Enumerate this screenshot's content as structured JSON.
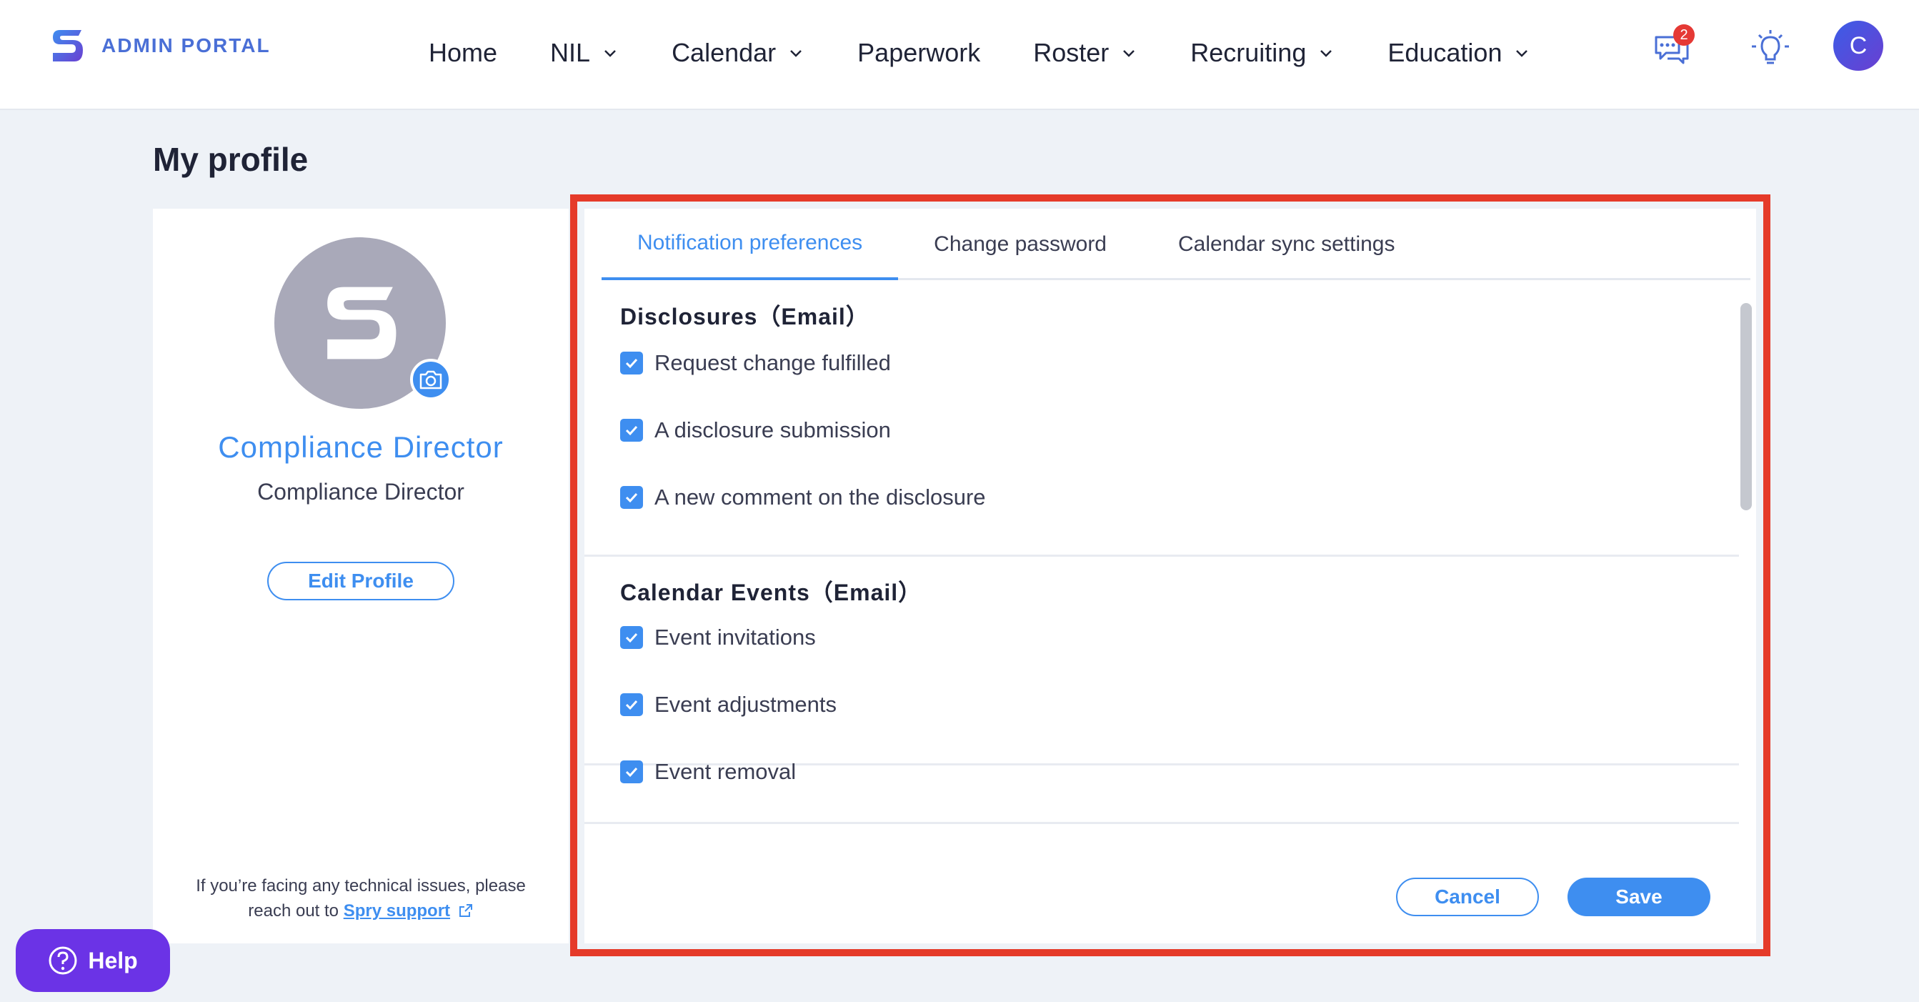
{
  "brand": {
    "name": "ADMIN PORTAL"
  },
  "nav": {
    "items": [
      {
        "label": "Home",
        "dropdown": false
      },
      {
        "label": "NIL",
        "dropdown": true
      },
      {
        "label": "Calendar",
        "dropdown": true
      },
      {
        "label": "Paperwork",
        "dropdown": false
      },
      {
        "label": "Roster",
        "dropdown": true
      },
      {
        "label": "Recruiting",
        "dropdown": true
      },
      {
        "label": "Education",
        "dropdown": true
      }
    ],
    "chat_badge": "2",
    "avatar_initial": "C"
  },
  "page": {
    "title": "My profile"
  },
  "profile": {
    "name": "Compliance Director",
    "role": "Compliance Director",
    "edit_label": "Edit Profile",
    "support_text_1": "If you’re facing any technical issues, please",
    "support_text_2": "reach out to",
    "support_link": "Spry support"
  },
  "tabs": [
    {
      "label": "Notification preferences",
      "active": true
    },
    {
      "label": "Change password",
      "active": false
    },
    {
      "label": "Calendar sync settings",
      "active": false
    }
  ],
  "sections": [
    {
      "title": "Disclosures（Email）",
      "items": [
        {
          "label": "Request change fulfilled",
          "checked": true
        },
        {
          "label": "A disclosure submission",
          "checked": true
        },
        {
          "label": "A new comment on the disclosure",
          "checked": true
        }
      ]
    },
    {
      "title": "Calendar Events（Email）",
      "items": [
        {
          "label": "Event invitations",
          "checked": true
        },
        {
          "label": "Event adjustments",
          "checked": true
        },
        {
          "label": "Event removal",
          "checked": true
        }
      ]
    }
  ],
  "actions": {
    "cancel": "Cancel",
    "save": "Save"
  },
  "help": {
    "label": "Help"
  },
  "colors": {
    "accent": "#3e8ef0",
    "highlight": "#e53b2a",
    "help": "#6b33e6"
  }
}
